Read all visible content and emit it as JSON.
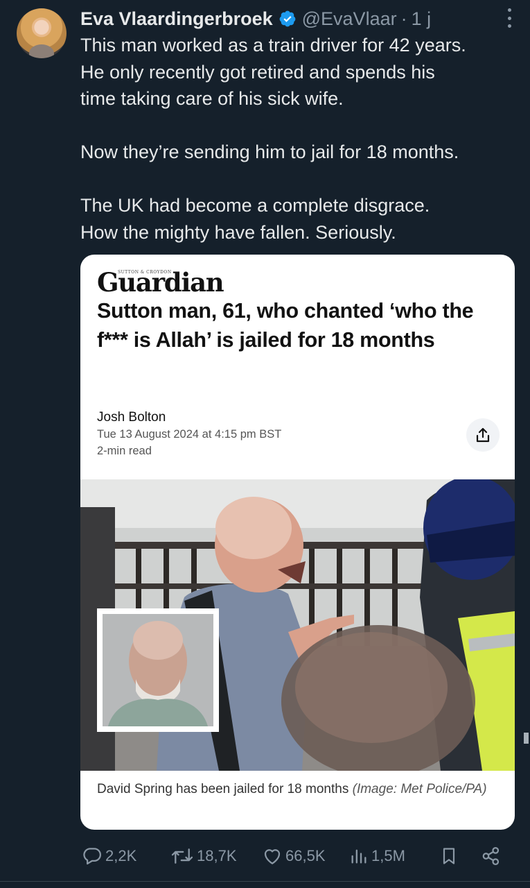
{
  "tweet": {
    "author_name": "Eva Vlaardingerbroek",
    "handle": "@EvaVlaar",
    "separator": "·",
    "time": "1 j",
    "lines": [
      "This man worked as a train driver for 42 years.",
      "He only recently got retired and spends his",
      "time taking care of his sick wife.",
      "Now they’re sending him to jail for 18 months.",
      "The UK had become a complete disgrace.",
      "How the mighty have fallen. Seriously."
    ]
  },
  "article_card": {
    "masthead_small": "SUTTON & CROYDON",
    "masthead": "Guardian",
    "headline": "Sutton man, 61, who chanted ‘who the f*** is Allah’ is jailed for 18 months",
    "author": "Josh Bolton",
    "date": "Tue 13 August 2024 at 4:15 pm BST",
    "read_time": "2-min read",
    "caption": "David Spring has been jailed for 18 months",
    "caption_credit": "(Image: Met Police/PA)"
  },
  "actions": {
    "replies": "2,2K",
    "reposts": "18,7K",
    "likes": "66,5K",
    "views": "1,5M"
  },
  "icons": [
    "verified-badge-icon",
    "more-options-icon",
    "share-icon",
    "reply-icon",
    "repost-icon",
    "like-icon",
    "views-icon",
    "bookmark-icon",
    "share-network-icon"
  ],
  "colors": {
    "background": "#15202b",
    "text": "#e7e9ea",
    "muted": "#8b98a5",
    "verified": "#1d9bf0",
    "card": "#ffffff"
  }
}
